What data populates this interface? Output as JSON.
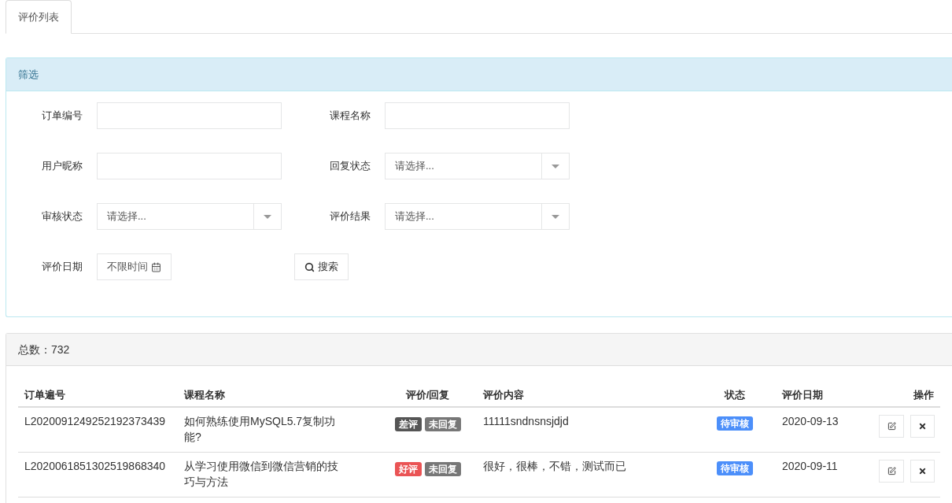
{
  "tabs": [
    {
      "label": "评价列表",
      "selected": true
    }
  ],
  "filter": {
    "title": "筛选",
    "fields": [
      {
        "kind": "text",
        "label": "订单编号"
      },
      {
        "kind": "text",
        "label": "课程名称"
      },
      {
        "kind": "text",
        "label": "用户昵称"
      },
      {
        "kind": "select",
        "label": "回复状态",
        "placeholder": "请选择..."
      },
      {
        "kind": "select",
        "label": "审核状态",
        "placeholder": "请选择..."
      },
      {
        "kind": "select",
        "label": "评价结果",
        "placeholder": "请选择..."
      },
      {
        "kind": "date",
        "label": "评价日期",
        "value": "不限时间"
      }
    ],
    "search_button": "搜索"
  },
  "list": {
    "total": "总数：732",
    "columns": [
      "订单遍号",
      "课程名称",
      "评价/回复",
      "评价内容",
      "状态",
      "评价日期",
      "操作"
    ],
    "rows": [
      {
        "order": "L2020091249252192373439",
        "course": "如何熟练使用MySQL5.7复制功能?",
        "rating": {
          "label": "差评",
          "color": "#555555"
        },
        "reply": {
          "label": "未回复",
          "color": "#777777"
        },
        "content": "11111sndnsnsjdjd",
        "status": {
          "label": "待审核",
          "color": "#4c8ffa"
        },
        "date": "2020-09-13"
      },
      {
        "order": "L2020061851302519868340",
        "course": "从学习使用微信到微信营销的技巧与方法",
        "rating": {
          "label": "好评",
          "color": "#ea5455"
        },
        "reply": {
          "label": "未回复",
          "color": "#777777"
        },
        "content": "很好，很棒，不错，测试而已",
        "status": {
          "label": "待审核",
          "color": "#4c8ffa"
        },
        "date": "2020-09-11"
      }
    ]
  }
}
